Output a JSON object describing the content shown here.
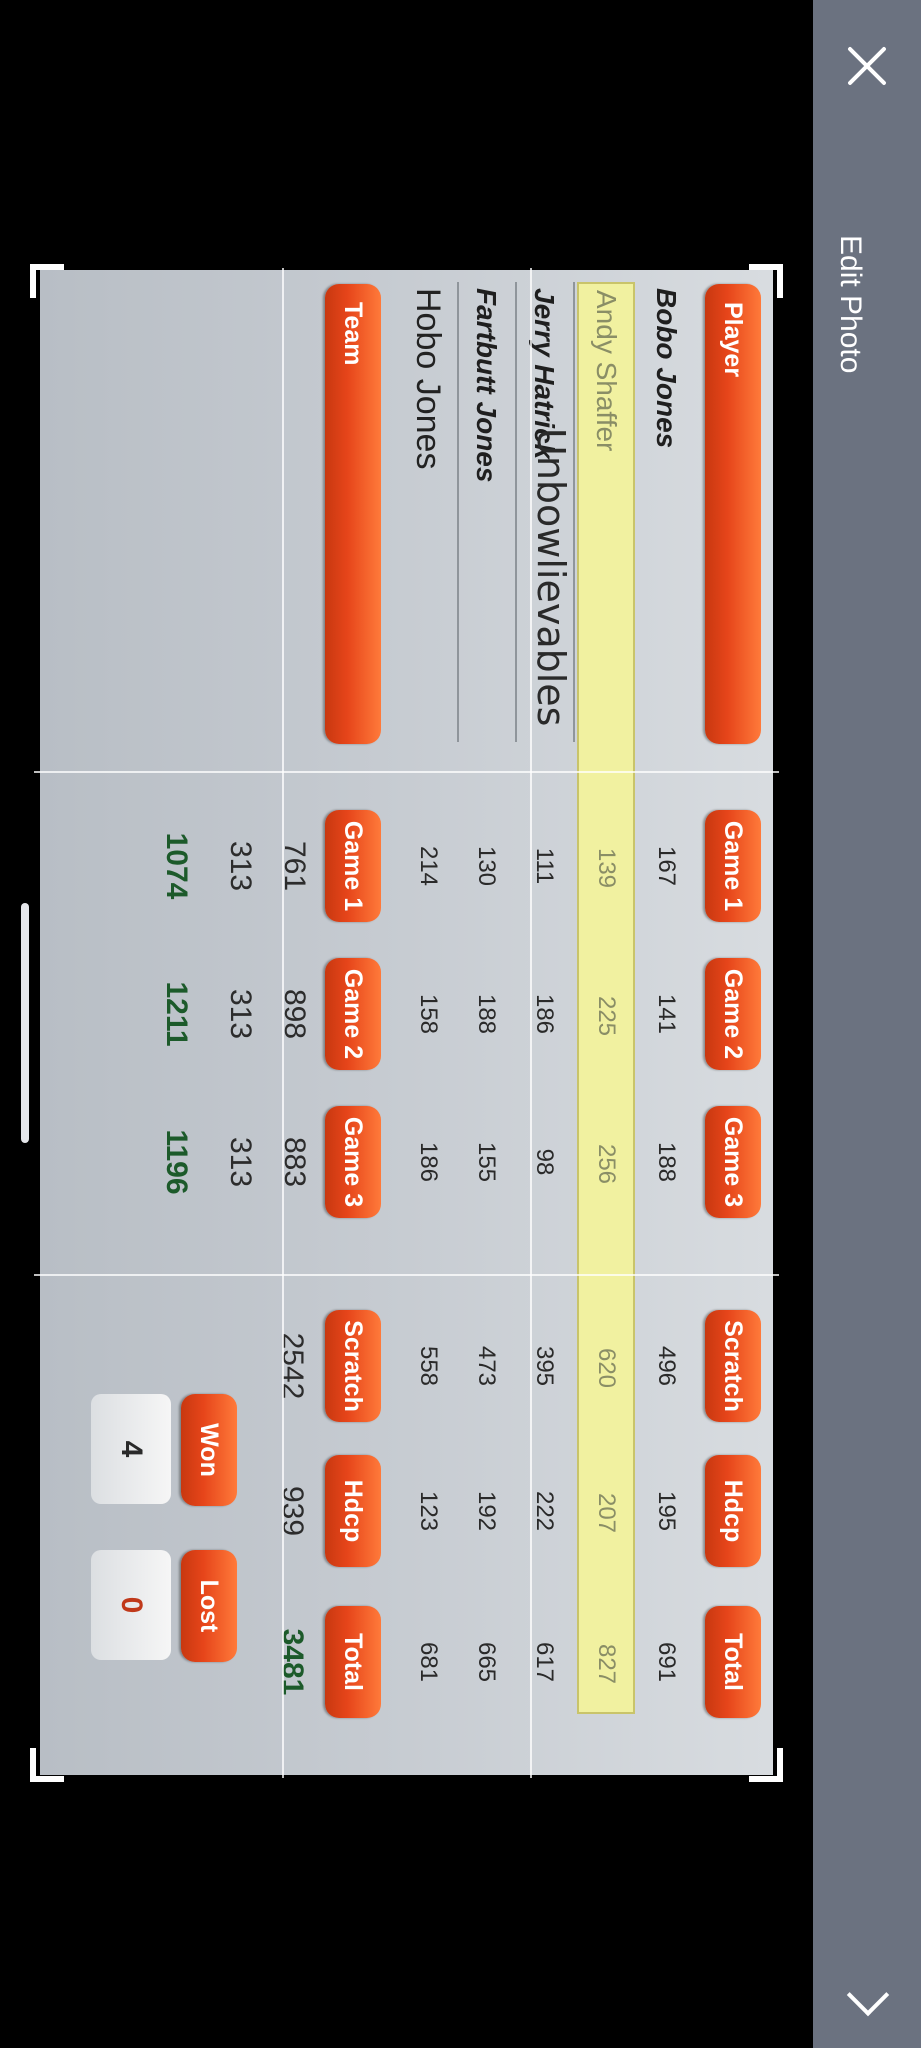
{
  "toolbar": {
    "title": "Edit Photo"
  },
  "scoreboard": {
    "player_header": "Player",
    "game_headers": [
      "Game 1",
      "Game 2",
      "Game 3"
    ],
    "summary_headers": [
      "Scratch",
      "Hdcp",
      "Total"
    ],
    "players": [
      {
        "name": "Bobo Jones",
        "g1": "167",
        "g2": "141",
        "g3": "188",
        "scratch": "496",
        "hdcp": "195",
        "total": "691"
      },
      {
        "name": "Andy Shaffer",
        "g1": "139",
        "g2": "225",
        "g3": "256",
        "scratch": "620",
        "hdcp": "207",
        "total": "827"
      },
      {
        "name": "Jerry Hatrick",
        "g1": "111",
        "g2": "186",
        "g3": "98",
        "scratch": "395",
        "hdcp": "222",
        "total": "617"
      },
      {
        "name": "Fartbutt Jones",
        "g1": "130",
        "g2": "188",
        "g3": "155",
        "scratch": "473",
        "hdcp": "192",
        "total": "665"
      },
      {
        "name": "Hobo Jones",
        "g1": "214",
        "g2": "158",
        "g3": "186",
        "scratch": "558",
        "hdcp": "123",
        "total": "681"
      }
    ],
    "team_header": "Team",
    "team_name": "Unbowlievables",
    "team_game_headers": [
      "Game 1",
      "Game 2",
      "Game 3"
    ],
    "team_scratch_row": [
      "761",
      "898",
      "883"
    ],
    "team_hdcp_row": [
      "313",
      "313",
      "313"
    ],
    "team_total_row": [
      "1074",
      "1211",
      "1196"
    ],
    "team_summary_headers": [
      "Scratch",
      "Hdcp",
      "Total"
    ],
    "team_summary": {
      "scratch": "2542",
      "hdcp": "939",
      "total": "3481"
    },
    "won_label": "Won",
    "lost_label": "Lost",
    "won": "4",
    "lost": "0"
  },
  "colors": {
    "toolbar_bg": "#6b7280",
    "header_orange": "#e6451a",
    "highlight": "#f1f1a0"
  }
}
